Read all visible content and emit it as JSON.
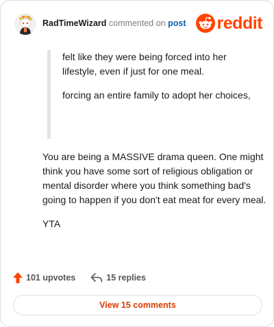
{
  "header": {
    "username": "RadTimeWizard",
    "action_text": "commented on",
    "post_link": "post",
    "logo_text": "reddit"
  },
  "quote": {
    "paragraphs": [
      "felt like they were being forced into her lifestyle, even if just for one meal.",
      "forcing an entire family to adopt her choices,"
    ]
  },
  "comment": {
    "paragraphs": [
      "You are being a MASSIVE drama queen. One might think you have some sort of religious obligation or mental disorder where you think something bad's going to happen if you don't eat meat for every meal.",
      "YTA"
    ]
  },
  "actions": {
    "upvotes_label": "101 upvotes",
    "replies_label": "15 replies"
  },
  "view_button": {
    "label": "View 15 comments"
  },
  "colors": {
    "brand": "#ff4500",
    "link": "#0b5fb0",
    "view_text": "#d93a00"
  },
  "icons": {
    "avatar": "snoo-avatar",
    "logo": "reddit-snoo-icon",
    "upvote": "upvote-arrow-icon",
    "reply": "reply-arrow-icon"
  }
}
